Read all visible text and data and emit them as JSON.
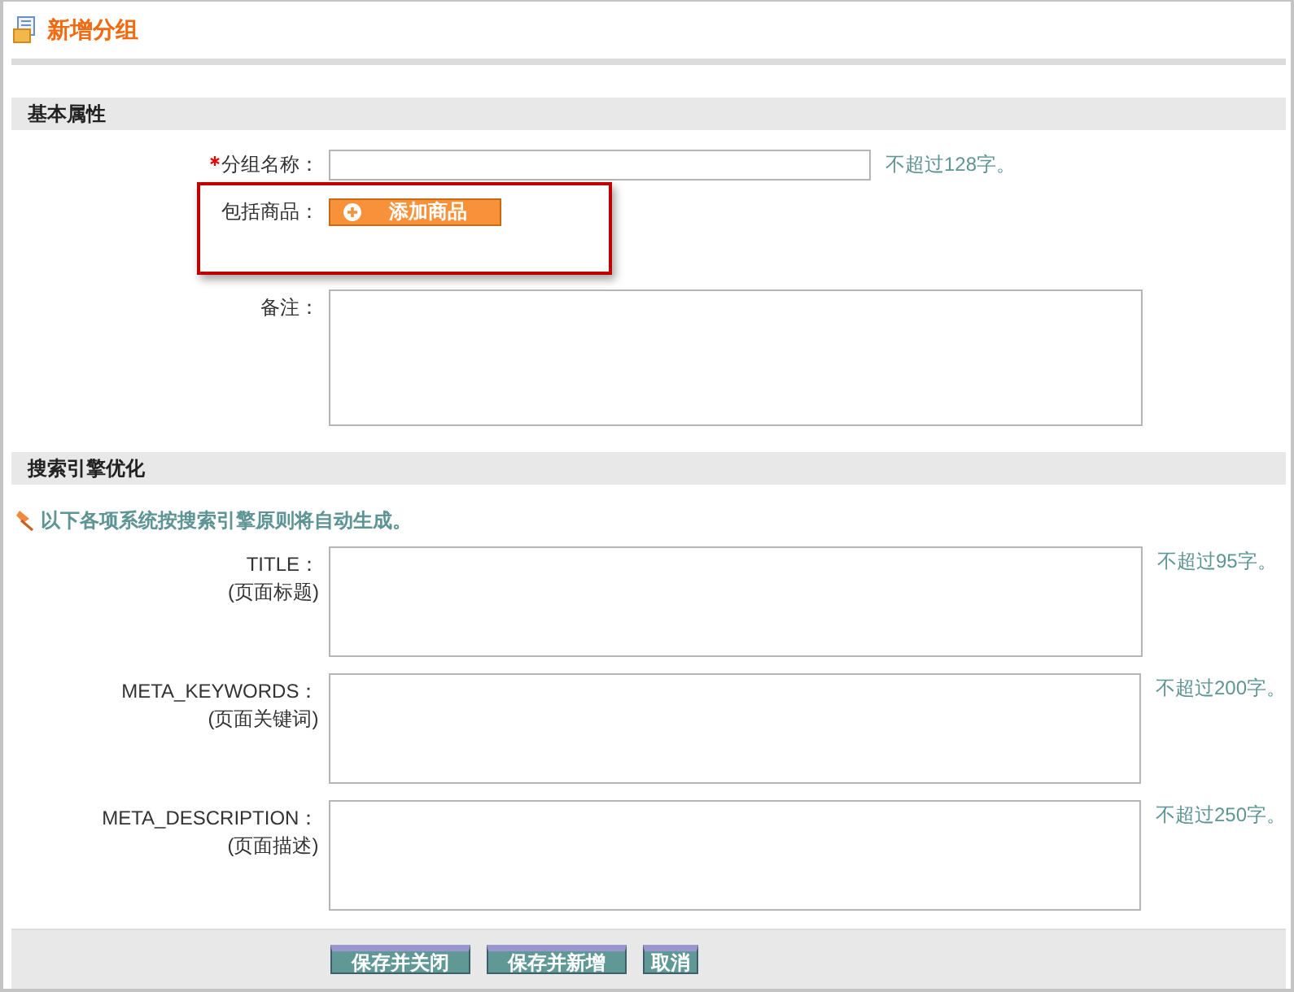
{
  "header": {
    "title": "新增分组"
  },
  "sections": [
    {
      "title": "基本属性",
      "fields": [
        {
          "kind": "input",
          "label": "分组名称：",
          "required": true,
          "hint": "不超过128字。"
        },
        {
          "kind": "button",
          "label": "包括商品：",
          "required": false,
          "button": "添加商品",
          "highlighted": true
        },
        {
          "kind": "textarea",
          "label": "备注：",
          "required": false
        }
      ]
    },
    {
      "title": "搜索引擎优化",
      "note": "以下各项系统按搜索引擎原则将自动生成。",
      "fields": [
        {
          "kind": "textarea",
          "label": "TITLE：",
          "sublabel": "(页面标题)",
          "required": false,
          "hint": "不超过95字。"
        },
        {
          "kind": "textarea",
          "label": "META_KEYWORDS：",
          "sublabel": "(页面关键词)",
          "required": false,
          "hint": "不超过200字。"
        },
        {
          "kind": "textarea",
          "label": "META_DESCRIPTION：",
          "sublabel": "(页面描述)",
          "required": false,
          "hint": "不超过250字。"
        }
      ]
    }
  ],
  "buttons": [
    "保存并关闭",
    "保存并新增",
    "取消"
  ]
}
